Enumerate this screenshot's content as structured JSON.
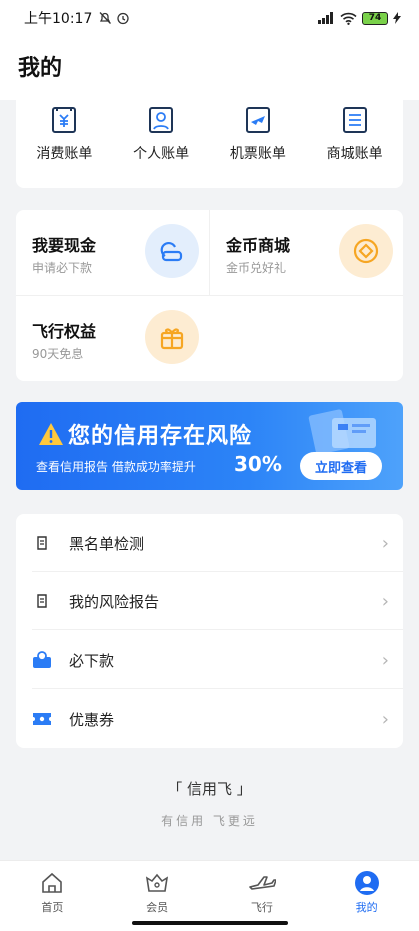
{
  "status_bar": {
    "time": "上午10:17",
    "battery": "74"
  },
  "header": {
    "title": "我的"
  },
  "bills": [
    {
      "label": "消费账单",
      "icon": "consume-bill-icon"
    },
    {
      "label": "个人账单",
      "icon": "personal-bill-icon"
    },
    {
      "label": "机票账单",
      "icon": "ticket-bill-icon"
    },
    {
      "label": "商城账单",
      "icon": "mall-bill-icon"
    }
  ],
  "services": [
    {
      "title": "我要现金",
      "subtitle": "申请必下款",
      "icon": "cash-icon"
    },
    {
      "title": "金币商城",
      "subtitle": "金币兑好礼",
      "icon": "coin-icon"
    },
    {
      "title": "飞行权益",
      "subtitle": "90天免息",
      "icon": "gift-icon"
    }
  ],
  "banner": {
    "headline": "您的信用存在风险",
    "subtitle": "查看信用报告 借款成功率提升",
    "percent": "30%",
    "button": "立即查看"
  },
  "menu": [
    {
      "label": "黑名单检测",
      "icon": "blacklist-doc-icon"
    },
    {
      "label": "我的风险报告",
      "icon": "risk-report-icon"
    },
    {
      "label": "必下款",
      "icon": "loan-icon"
    },
    {
      "label": "优惠券",
      "icon": "coupon-icon"
    }
  ],
  "footer": {
    "brand": "「 信用飞 」",
    "slogan": "有信用  飞更远"
  },
  "tabs": [
    {
      "label": "首页",
      "icon": "home-icon",
      "active": false
    },
    {
      "label": "会员",
      "icon": "member-icon",
      "active": false
    },
    {
      "label": "飞行",
      "icon": "plane-icon",
      "active": false
    },
    {
      "label": "我的",
      "icon": "profile-icon",
      "active": true
    }
  ],
  "colors": {
    "accent": "#1f6cf2",
    "orange": "#f6a623",
    "background": "#f2f3f5"
  }
}
